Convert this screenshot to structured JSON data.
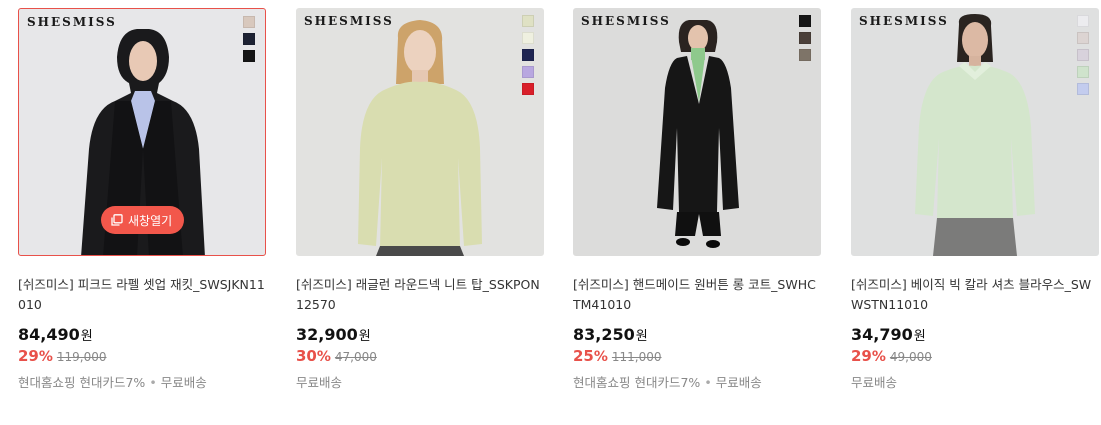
{
  "new_window_label": "새창열기",
  "currency": "원",
  "products": [
    {
      "brand": "SHESMISS",
      "swatches": [
        "#d8c8bd",
        "#1d2233",
        "#151515"
      ],
      "title": "[쉬즈미스] 피크드 라펠 셋업 재킷_SWSJKN11010",
      "price": "84,490",
      "rate": "29",
      "original": "119,000",
      "shipping": [
        "현대홈쇼핑 현대카드7%",
        "무료배송"
      ]
    },
    {
      "brand": "SHESMISS",
      "swatches": [
        "#dfe1c4",
        "#eff0e0",
        "#1f2552",
        "#b8a7e0",
        "#d91f2a"
      ],
      "title": "[쉬즈미스] 래글런 라운드넥 니트 탑_SSKPON12570",
      "price": "32,900",
      "rate": "30",
      "original": "47,000",
      "shipping": [
        "무료배송"
      ]
    },
    {
      "brand": "SHESMISS",
      "swatches": [
        "#151515",
        "#4a3f39",
        "#7e7468"
      ],
      "title": "[쉬즈미스] 핸드메이드 원버튼 롱 코트_SWHCTM41010",
      "price": "83,250",
      "rate": "25",
      "original": "111,000",
      "shipping": [
        "현대홈쇼핑 현대카드7%",
        "무료배송"
      ]
    },
    {
      "brand": "SHESMISS",
      "swatches": [
        "#ececef",
        "#dcd4d2",
        "#d8d2dc",
        "#cfe3cc",
        "#c3ccee"
      ],
      "title": "[쉬즈미스] 베이직 빅 칼라 셔츠 블라우스_SWWSTN11010",
      "price": "34,790",
      "rate": "29",
      "original": "49,000",
      "shipping": [
        "무료배송"
      ]
    }
  ]
}
